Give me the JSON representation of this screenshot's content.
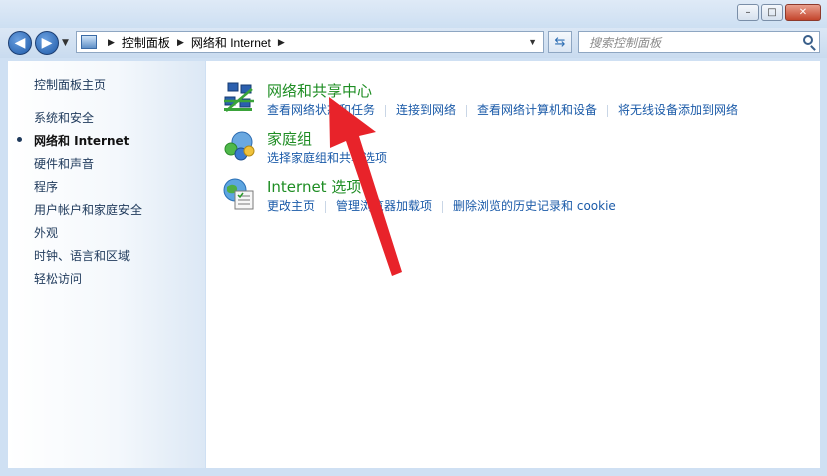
{
  "window": {
    "buttons": {
      "minimize": "–",
      "maximize": "□",
      "close": "✕"
    }
  },
  "nav": {
    "back_icon": "back-arrow-icon",
    "forward_icon": "forward-arrow-icon",
    "breadcrumb": [
      "控制面板",
      "网络和 Internet"
    ],
    "search_placeholder": "搜索控制面板"
  },
  "sidebar": {
    "home": "控制面板主页",
    "items": [
      {
        "label": "系统和安全",
        "active": false
      },
      {
        "label": "网络和 Internet",
        "active": true
      },
      {
        "label": "硬件和声音",
        "active": false
      },
      {
        "label": "程序",
        "active": false
      },
      {
        "label": "用户帐户和家庭安全",
        "active": false
      },
      {
        "label": "外观",
        "active": false
      },
      {
        "label": "时钟、语言和区域",
        "active": false
      },
      {
        "label": "轻松访问",
        "active": false
      }
    ]
  },
  "categories": [
    {
      "title": "网络和共享中心",
      "icon": "network-sharing-center-icon",
      "links": [
        "查看网络状态和任务",
        "连接到网络",
        "查看网络计算机和设备",
        "将无线设备添加到网络"
      ]
    },
    {
      "title": "家庭组",
      "icon": "homegroup-icon",
      "links": [
        "选择家庭组和共享选项"
      ]
    },
    {
      "title": "Internet 选项",
      "icon": "internet-options-icon",
      "links": [
        "更改主页",
        "管理浏览器加载项",
        "删除浏览的历史记录和 cookie"
      ]
    }
  ],
  "colors": {
    "category_title": "#1e8d23",
    "link": "#1a5aa8",
    "annotation_arrow": "#e8232a"
  }
}
